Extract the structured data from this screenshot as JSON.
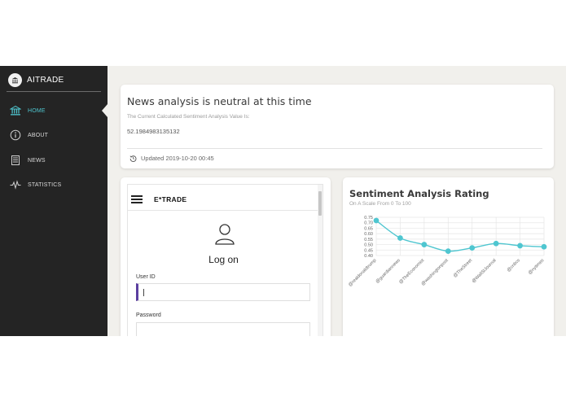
{
  "app": {
    "brand": "AITRADE"
  },
  "sidebar": {
    "items": [
      {
        "label": "HOME",
        "icon": "bank-icon",
        "active": true
      },
      {
        "label": "ABOUT",
        "icon": "info-icon",
        "active": false
      },
      {
        "label": "NEWS",
        "icon": "newspaper-icon",
        "active": false
      },
      {
        "label": "STATISTICS",
        "icon": "pulse-icon",
        "active": false
      }
    ]
  },
  "news": {
    "title": "News analysis is neutral at this time",
    "subtitle": "The Current Calculated Sentiment Analysis Value Is:",
    "value": "52.1984983135132",
    "updated": "Updated 2019-10-20 00:45"
  },
  "etrade": {
    "logo": "E*TRADE",
    "login_title": "Log on",
    "user_id_label": "User ID",
    "password_label": "Password"
  },
  "colors": {
    "accent": "#4fc6d0",
    "sidebar_bg": "#242424",
    "focus": "#5b3fa0"
  },
  "chart_data": {
    "type": "line",
    "title": "Sentiment Analysis Rating",
    "subtitle": "On A Scale From 0 To 100",
    "categories": [
      "@realdonaldtrump",
      "@guardiannews",
      "@TheEconomist",
      "@washingtonpost",
      "@TheStreet",
      "@WallStJournal",
      "@cnbcs",
      "@nytimes"
    ],
    "values": [
      0.72,
      0.56,
      0.5,
      0.44,
      0.47,
      0.51,
      0.49,
      0.48
    ],
    "y_ticks": [
      "0.40",
      "0.45",
      "0.50",
      "0.55",
      "0.60",
      "0.65",
      "0.70",
      "0.75"
    ],
    "ylim": [
      0.4,
      0.75
    ],
    "grid": true,
    "color": "#4fc6d0"
  }
}
